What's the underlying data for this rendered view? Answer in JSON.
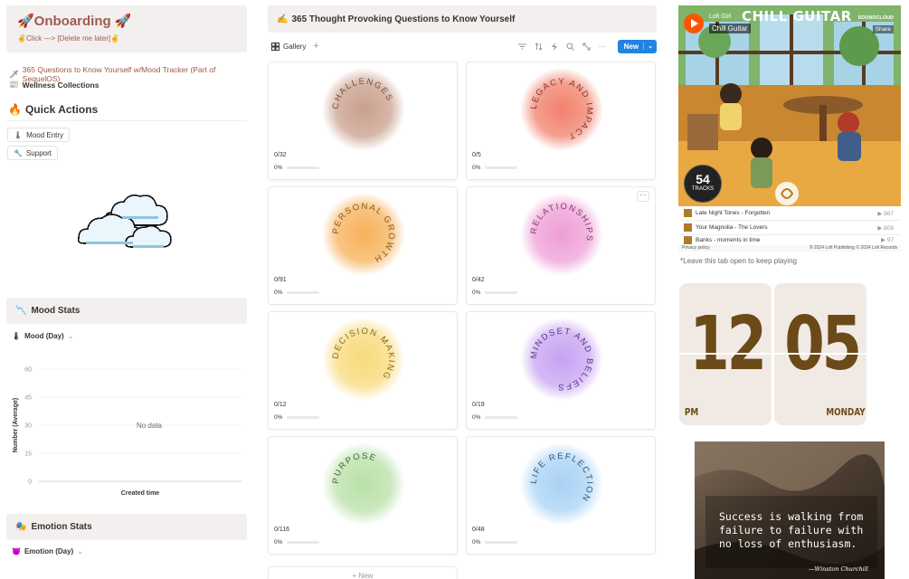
{
  "left": {
    "onboarding": {
      "title": "🚀Onboarding 🚀",
      "subtitle": "✌️Click —> [Delete me later]✌️"
    },
    "links": [
      {
        "icon": "🗡",
        "label": "365 Questions to Know Yourself w/Mood Tracker (Part of SequelOS)"
      },
      {
        "icon": "📰",
        "label": "Wellness Collections"
      }
    ],
    "quick_actions": {
      "icon": "🔥",
      "title": "Quick Actions",
      "buttons": [
        {
          "icon": "🌡",
          "label": "Mood Entry"
        },
        {
          "icon": "🔧",
          "label": "Support"
        }
      ]
    },
    "mood_stats": {
      "icon": "📉",
      "title": "Mood Stats",
      "property_icon": "🌡",
      "property": "Mood (Day)",
      "chevron": "⌄"
    },
    "emotion_stats": {
      "icon": "🎭",
      "title": "Emotion Stats",
      "property_icon": "😈",
      "property": "Emotion (Day)",
      "chevron": "⌄"
    }
  },
  "chart_data": {
    "type": "bar",
    "categories": [],
    "values": [],
    "title": "",
    "xlabel": "Created time",
    "ylabel": "Number (Average)",
    "ylim": [
      0,
      60
    ],
    "yticks": [
      0,
      15,
      30,
      45,
      60
    ],
    "grid": true,
    "empty_message": "No data"
  },
  "middle": {
    "title_icon": "✍️",
    "title": "365 Thought Provoking Questions to Know Yourself",
    "view_tab": "Gallery",
    "add_view": "+",
    "new_label": "New",
    "new_caret": "⌄",
    "new_card_label": "+ New",
    "more_label": "···",
    "cards": [
      {
        "name": "CHALLENGES",
        "count": "0/32",
        "percent": "0%",
        "progress": 0,
        "color": "#c99f8c",
        "text_color": "#7a5143"
      },
      {
        "name": "LEGACY AND IMPACT",
        "count": "0/5",
        "percent": "0%",
        "progress": 0,
        "color": "#f2806b",
        "text_color": "#8a3728"
      },
      {
        "name": "PERSONAL GROWTH",
        "count": "0/91",
        "percent": "0%",
        "progress": 0,
        "color": "#f7b15a",
        "text_color": "#8a5a1c"
      },
      {
        "name": "RELATIONSHIPS",
        "count": "0/42",
        "percent": "0%",
        "progress": 0,
        "color": "#ee9ed6",
        "text_color": "#8a3c73"
      },
      {
        "name": "DECISION MAKING",
        "count": "0/12",
        "percent": "0%",
        "progress": 0,
        "color": "#f8da7a",
        "text_color": "#8a6a1c"
      },
      {
        "name": "MINDSET AND BELIEFS",
        "count": "0/19",
        "percent": "0%",
        "progress": 0,
        "color": "#c6a3f2",
        "text_color": "#5c3a8a"
      },
      {
        "name": "PURPOSE",
        "count": "0/116",
        "percent": "0%",
        "progress": 0,
        "color": "#b9e0a7",
        "text_color": "#3f6b34"
      },
      {
        "name": "LIFE REFLECTION",
        "count": "0/48",
        "percent": "0%",
        "progress": 0,
        "color": "#a9d2f5",
        "text_color": "#2e5a7d"
      }
    ]
  },
  "player": {
    "artist": "Lofi Girl",
    "track": "Chill Guitar",
    "banner": "CHILL GUITAR",
    "logo": "SOUNDCLOUD",
    "share": "Share",
    "tracks_count": "54",
    "tracks_label": "TRACKS",
    "tracks": [
      {
        "title": "Late Night Tones - Forgotten",
        "plays": "▶ 967"
      },
      {
        "title": "Your Magnolia - The Lovers",
        "plays": "▶ 808"
      },
      {
        "title": "Banks - moments in time",
        "plays": "▶ 97"
      }
    ],
    "privacy": "Privacy policy",
    "copyright": "® 2024 Lofi Publishing © 2024 Lofi Records",
    "keep_open": "*Leave this tab open to keep playing"
  },
  "clock": {
    "hours": "12",
    "minutes": "05",
    "ampm": "PM",
    "day": "MONDAY",
    "text_color": "#6b4a18",
    "bg_color": "#f1eae4"
  },
  "quote": {
    "text": "Success is walking from failure to failure with no loss of enthusiasm.",
    "author": "—Winston Churchill"
  }
}
